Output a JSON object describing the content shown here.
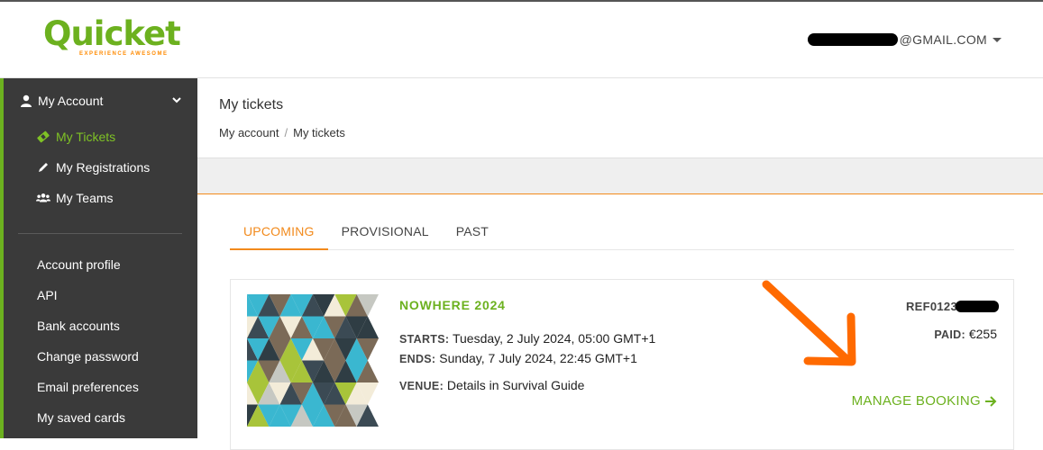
{
  "header": {
    "logo_text": "Quicket",
    "logo_tagline": "EXPERIENCE AWESOME",
    "user_email_suffix": "@GMAIL.COM"
  },
  "sidebar": {
    "section_title": "My Account",
    "sub_items": [
      {
        "label": "My Tickets",
        "icon": "ticket-icon",
        "active": true
      },
      {
        "label": "My Registrations",
        "icon": "pencil-icon",
        "active": false
      },
      {
        "label": "My Teams",
        "icon": "users-icon",
        "active": false
      }
    ],
    "links": [
      "Account profile",
      "API",
      "Bank accounts",
      "Change password",
      "Email preferences",
      "My saved cards"
    ]
  },
  "main": {
    "page_title": "My tickets",
    "breadcrumb": [
      "My account",
      "My tickets"
    ],
    "tabs": [
      {
        "label": "UPCOMING",
        "active": true
      },
      {
        "label": "PROVISIONAL",
        "active": false
      },
      {
        "label": "PAST",
        "active": false
      }
    ],
    "booking": {
      "event_name": "NOWHERE 2024",
      "starts_label": "STARTS:",
      "starts_value": "Tuesday, 2 July 2024, 05:00 GMT+1",
      "ends_label": "ENDS:",
      "ends_value": "Sunday, 7 July 2024, 22:45 GMT+1",
      "venue_label": "VENUE:",
      "venue_value": "Details in Survival Guide",
      "ref_prefix": "REF0123",
      "paid_label": "PAID:",
      "paid_value": "€255",
      "manage_label": "MANAGE BOOKING"
    }
  },
  "colors": {
    "brand_green": "#6cb11f",
    "accent_orange": "#f28a1c",
    "sidebar_bg": "#3a3a3a"
  }
}
